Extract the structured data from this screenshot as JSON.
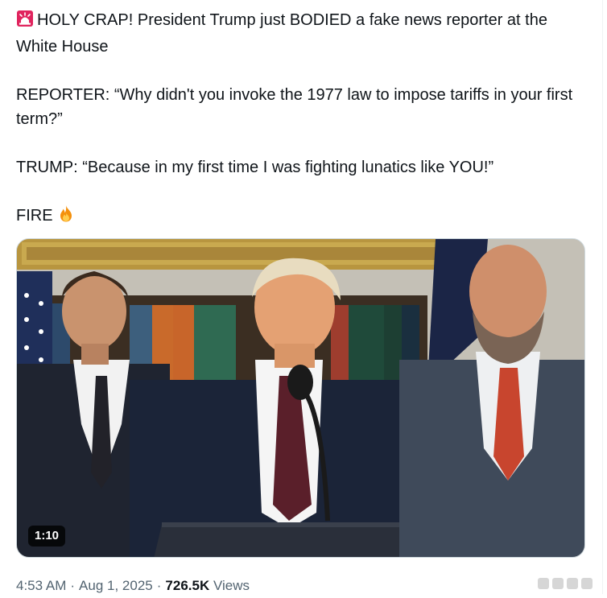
{
  "tweet": {
    "line1": "HOLY CRAP! President Trump just BODIED a fake news reporter at the White House",
    "line2": "REPORTER: “Why didn't you invoke the 1977 law to impose tariffs in your first term?”",
    "line3": "TRUMP: “Because in my first time I was fighting lunatics like YOU!”",
    "line4": "FIRE",
    "leading_icon": "police-siren-icon",
    "trailing_icon": "fire-icon"
  },
  "media": {
    "type": "video",
    "duration": "1:10"
  },
  "meta": {
    "time": "4:53 AM",
    "separator": "·",
    "date": "Aug 1, 2025",
    "views_count": "726.5K",
    "views_label": "Views"
  },
  "colors": {
    "text": "#0f1419",
    "secondary_text": "#536471",
    "border": "#cfd9de",
    "siren_red": "#e0245e",
    "fire_orange": "#f4900c"
  }
}
